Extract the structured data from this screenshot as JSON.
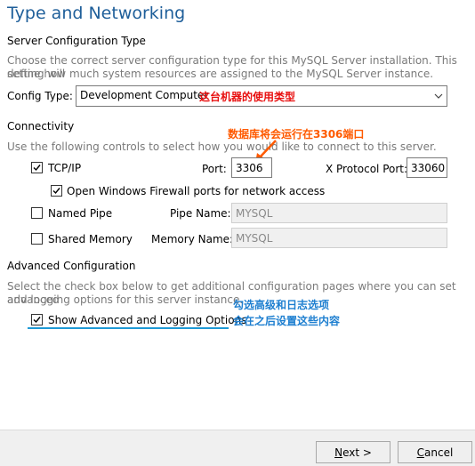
{
  "page": {
    "title": "Type and Networking"
  },
  "server_config": {
    "section_title": "Server Configuration Type",
    "description_line1": "Choose the correct server configuration type for this MySQL Server installation. This setting will",
    "description_line2": "define how much system resources are assigned to the MySQL Server instance.",
    "config_type_label": "Config Type:",
    "config_type_value": "Development Computer",
    "annotation": "这台机器的使用类型"
  },
  "connectivity": {
    "section_title": "Connectivity",
    "description": "Use the following controls to select how you would like to connect to this server.",
    "annotation": "数据库将会运行在3306端口",
    "tcpip": {
      "label": "TCP/IP",
      "checked": true,
      "port_label": "Port:",
      "port_value": "3306",
      "xport_label": "X Protocol Port:",
      "xport_value": "33060"
    },
    "firewall": {
      "label": "Open Windows Firewall ports for network access",
      "checked": true
    },
    "named_pipe": {
      "label": "Named Pipe",
      "checked": false,
      "name_label": "Pipe Name:",
      "name_value": "MYSQL"
    },
    "shared_memory": {
      "label": "Shared Memory",
      "checked": false,
      "name_label": "Memory Name:",
      "name_value": "MYSQL"
    }
  },
  "advanced": {
    "section_title": "Advanced Configuration",
    "description_line1": "Select the check box below to get additional configuration pages where you can set advanced",
    "description_line2": "and logging options for this server instance.",
    "show_options": {
      "label": "Show Advanced and Logging Options",
      "checked": true
    },
    "annotation_line1": "勾选高级和日志选项",
    "annotation_line2": "会在之后设置这些内容"
  },
  "footer": {
    "next_prefix": "N",
    "next_rest": "ext >",
    "cancel_prefix": "C",
    "cancel_rest": "ancel"
  },
  "colors": {
    "title": "#1f5f9a",
    "annotation_orange": "#ff5a00",
    "annotation_red": "#e81010",
    "annotation_blue": "#1e7fd0"
  }
}
